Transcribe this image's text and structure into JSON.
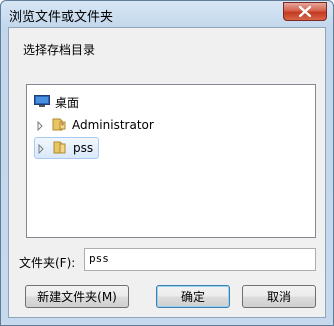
{
  "window": {
    "title": "浏览文件或文件夹"
  },
  "dialog": {
    "prompt": "选择存档目录"
  },
  "tree": {
    "items": [
      {
        "label": "桌面",
        "icon": "desktop-icon"
      },
      {
        "label": "Administrator",
        "icon": "user-folder-icon"
      },
      {
        "label": "pss",
        "icon": "folder-icon",
        "selected": true
      }
    ]
  },
  "folder": {
    "label": "文件夹(F):",
    "value": "pss"
  },
  "buttons": {
    "new_folder": "新建文件夹(M)",
    "ok": "确定",
    "cancel": "取消"
  },
  "colors": {
    "selection": "#d9e9fb",
    "close": "#c4391f",
    "titlebar": "#c3d7ec"
  }
}
